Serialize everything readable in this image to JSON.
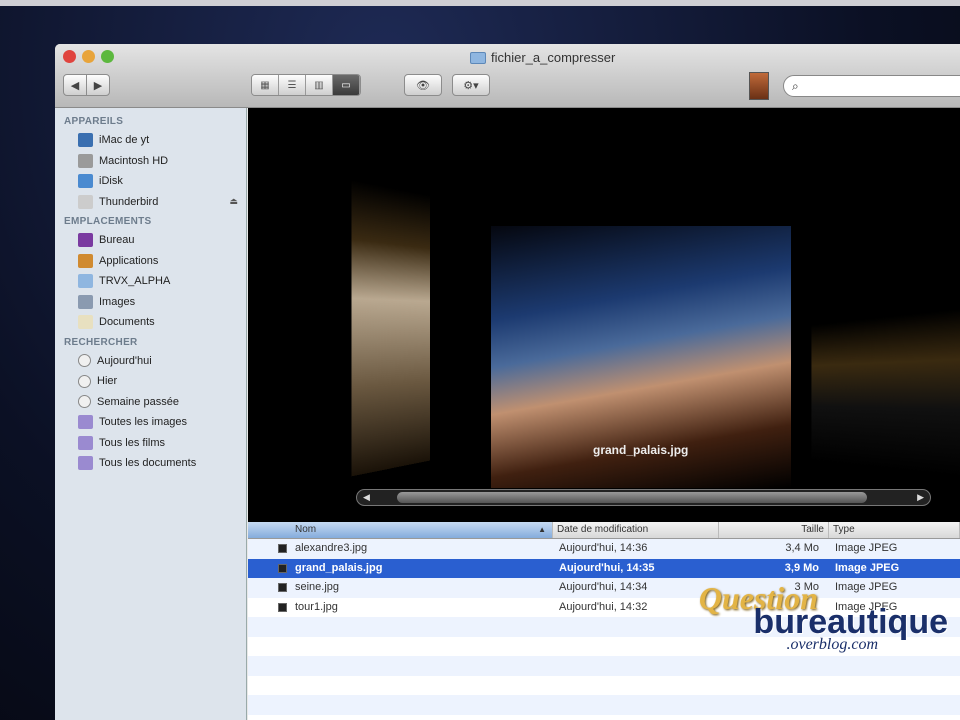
{
  "window": {
    "title": "fichier_a_compresser"
  },
  "toolbar": {
    "back": "◀",
    "forward": "▶",
    "views": [
      "list-icon",
      "columns-icon",
      "grid-icon",
      "coverflow-icon"
    ],
    "quicklook": "👁",
    "action": "⚙▾",
    "search_placeholder": ""
  },
  "sidebar": {
    "sections": [
      {
        "title": "APPAREILS",
        "items": [
          {
            "label": "iMac de yt",
            "icon": "imac-icon",
            "color": "#3a6fb0"
          },
          {
            "label": "Macintosh HD",
            "icon": "hard-drive-icon",
            "color": "#9a9a9a"
          },
          {
            "label": "iDisk",
            "icon": "idisk-icon",
            "color": "#4a8ad0"
          },
          {
            "label": "Thunderbird",
            "icon": "disk-image-icon",
            "color": "#cccccc",
            "eject": "⏏"
          }
        ]
      },
      {
        "title": "EMPLACEMENTS",
        "items": [
          {
            "label": "Bureau",
            "icon": "desktop-icon",
            "color": "#7a3aa0"
          },
          {
            "label": "Applications",
            "icon": "applications-icon",
            "color": "#d08a30"
          },
          {
            "label": "TRVX_ALPHA",
            "icon": "folder-icon",
            "color": "#8fb6e0"
          },
          {
            "label": "Images",
            "icon": "pictures-icon",
            "color": "#8a9ab0"
          },
          {
            "label": "Documents",
            "icon": "documents-icon",
            "color": "#e8e0c0"
          }
        ]
      },
      {
        "title": "RECHERCHER",
        "items": [
          {
            "label": "Aujourd'hui",
            "icon": "clock-icon",
            "color": "#f0f0f0"
          },
          {
            "label": "Hier",
            "icon": "clock-icon",
            "color": "#f0f0f0"
          },
          {
            "label": "Semaine passée",
            "icon": "clock-icon",
            "color": "#f0f0f0"
          },
          {
            "label": "Toutes les images",
            "icon": "smart-folder-icon",
            "color": "#9a8ad0"
          },
          {
            "label": "Tous les films",
            "icon": "smart-folder-icon",
            "color": "#9a8ad0"
          },
          {
            "label": "Tous les documents",
            "icon": "smart-folder-icon",
            "color": "#9a8ad0"
          }
        ]
      }
    ]
  },
  "coverflow": {
    "caption": "grand_palais.jpg"
  },
  "list": {
    "columns": [
      "Nom",
      "Date de modification",
      "Taille",
      "Type"
    ],
    "sort_indicator": "▲",
    "rows": [
      {
        "name": "alexandre3.jpg",
        "date": "Aujourd'hui, 14:36",
        "size": "3,4 Mo",
        "type": "Image JPEG",
        "selected": false
      },
      {
        "name": "grand_palais.jpg",
        "date": "Aujourd'hui, 14:35",
        "size": "3,9 Mo",
        "type": "Image JPEG",
        "selected": true
      },
      {
        "name": "seine.jpg",
        "date": "Aujourd'hui, 14:34",
        "size": "3 Mo",
        "type": "Image JPEG",
        "selected": false
      },
      {
        "name": "tour1.jpg",
        "date": "Aujourd'hui, 14:32",
        "size": "",
        "type": "Image JPEG",
        "selected": false
      }
    ]
  },
  "watermark": {
    "line1": "Question",
    "line2": "bureautique",
    "line3": ".overblog.com"
  },
  "colors": {
    "selection": "#2a5fd0",
    "sidebar": "#dde4ec"
  }
}
